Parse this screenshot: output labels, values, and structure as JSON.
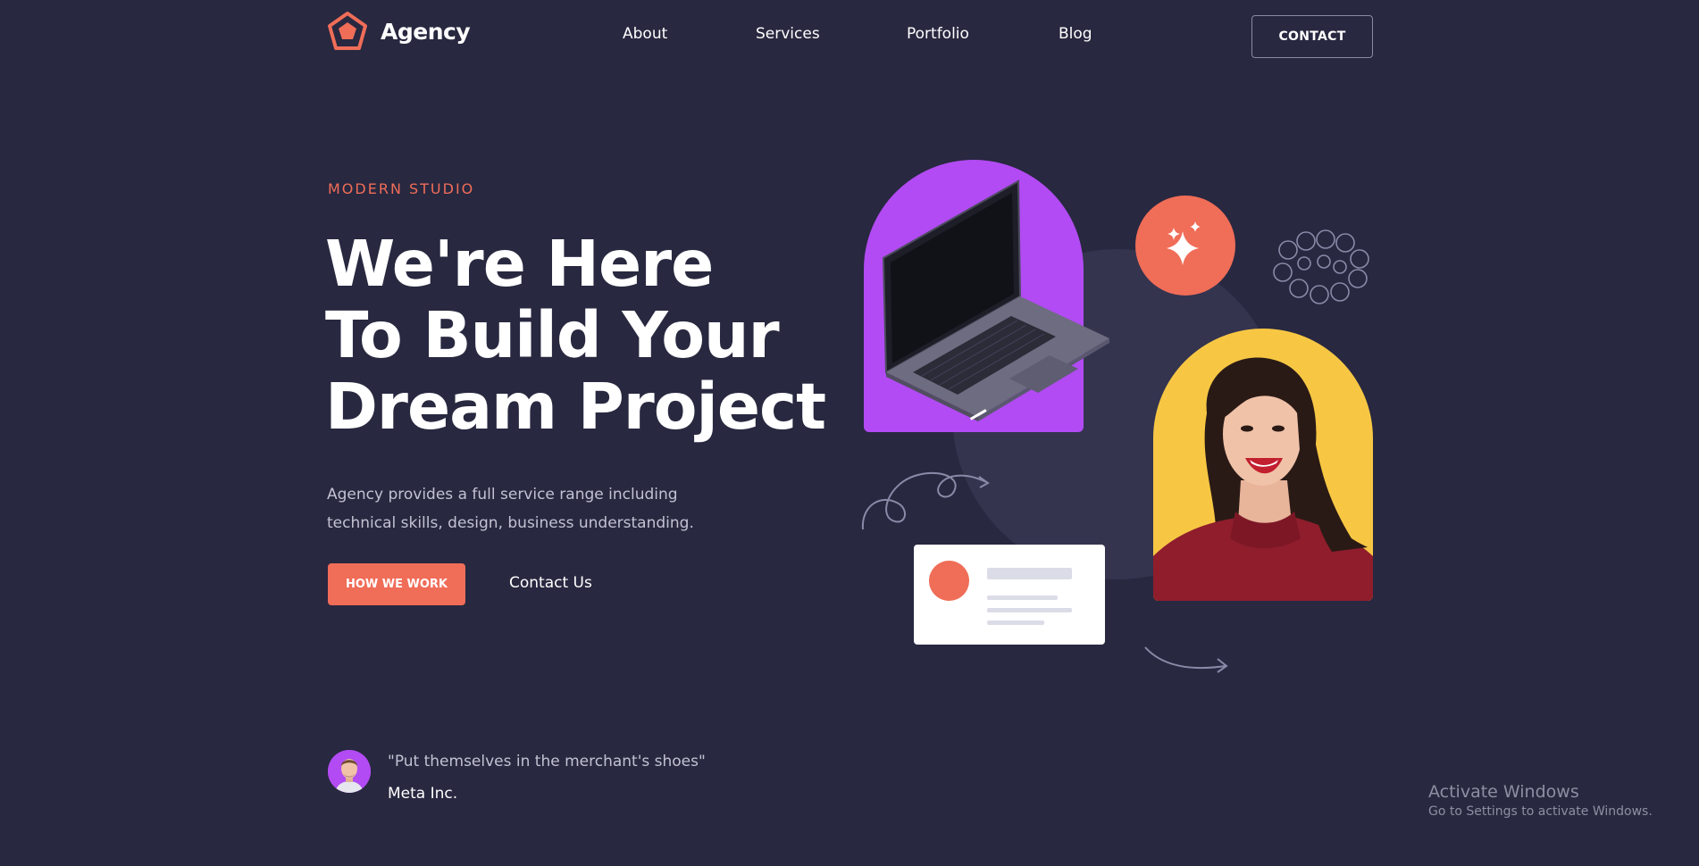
{
  "header": {
    "logo_text": "Agency",
    "nav": [
      {
        "label": "About"
      },
      {
        "label": "Services"
      },
      {
        "label": "Portfolio"
      },
      {
        "label": "Blog"
      }
    ],
    "contact_label": "CONTACT"
  },
  "hero": {
    "eyebrow": "MODERN STUDIO",
    "title_lines": [
      "We're Here",
      "To Build Your",
      "Dream Project"
    ],
    "description": "Agency provides a full service range including technical skills, design, business understanding.",
    "primary_button": "HOW WE WORK",
    "secondary_link": "Contact Us"
  },
  "testimonial": {
    "quote": "\"Put themselves in the merchant's shoes\"",
    "company": "Meta Inc."
  },
  "illustration": {
    "laptop": "laptop-image",
    "sparkle": "sparkle-icon",
    "portrait": "smiling-woman-photo"
  },
  "watermark": {
    "title": "Activate Windows",
    "subtitle": "Go to Settings to activate Windows."
  },
  "colors": {
    "background": "#282840",
    "accent": "#f06d58",
    "purple": "#b24bf3",
    "yellow": "#f7c744",
    "muted_text": "#c2c2d3"
  }
}
